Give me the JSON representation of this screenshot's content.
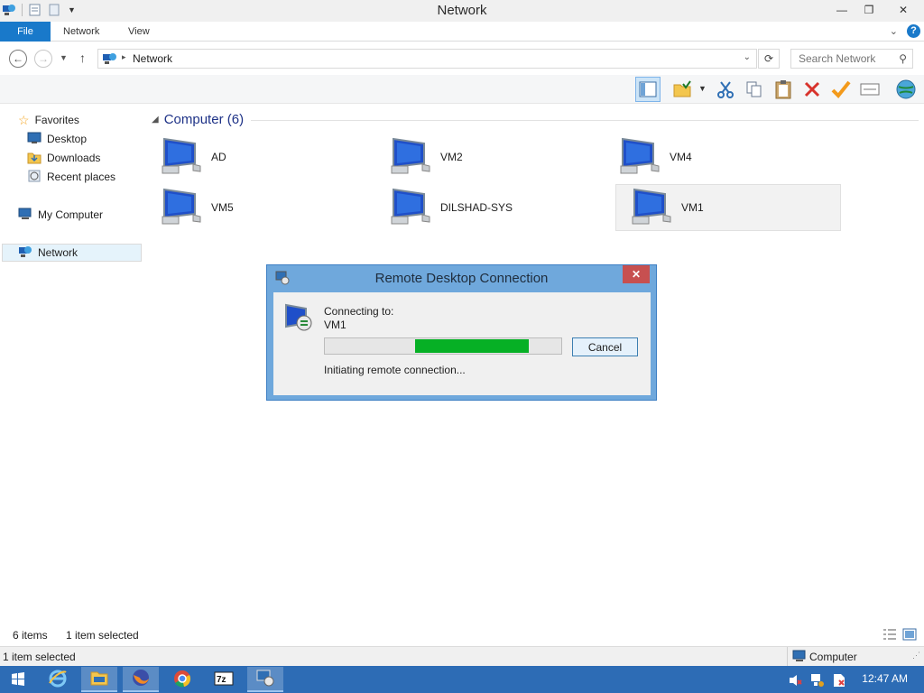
{
  "window": {
    "title": "Network"
  },
  "ribbon": {
    "tabs": [
      {
        "label": "File"
      },
      {
        "label": "Network"
      },
      {
        "label": "View"
      }
    ]
  },
  "address": {
    "crumb": "Network"
  },
  "search": {
    "placeholder": "Search Network"
  },
  "toolbar": {
    "icons": [
      "layout-pane-icon",
      "folder-properties-icon",
      "cut-icon",
      "copy-icon",
      "paste-icon",
      "delete-icon",
      "checkmark-icon",
      "rename-icon",
      "globe-icon"
    ]
  },
  "navpane": {
    "favorites": "Favorites",
    "desktop": "Desktop",
    "downloads": "Downloads",
    "recent": "Recent places",
    "computer": "My Computer",
    "network": "Network"
  },
  "content": {
    "group_header": "Computer (6)",
    "computers": [
      {
        "name": "AD"
      },
      {
        "name": "VM2"
      },
      {
        "name": "VM4"
      },
      {
        "name": "VM5"
      },
      {
        "name": "DILSHAD-SYS"
      },
      {
        "name": "VM1"
      }
    ],
    "selected": "VM1"
  },
  "status": {
    "items": "6 items",
    "selected": "1 item selected",
    "bottom_left": "1 item selected",
    "bottom_right": "Computer"
  },
  "dialog": {
    "title": "Remote Desktop Connection",
    "connecting_label": "Connecting to:",
    "target": "VM1",
    "progress_start": 0.38,
    "progress_end": 0.86,
    "cancel_label": "Cancel",
    "status_text": "Initiating remote connection..."
  },
  "taskbar": {
    "items": [
      "start-icon",
      "internet-explorer-icon",
      "file-explorer-icon",
      "firefox-icon",
      "chrome-icon",
      "7zip-icon",
      "remote-desktop-icon"
    ],
    "clock": "12:47 AM"
  },
  "colors": {
    "accent": "#1979ca",
    "taskbar": "#2d6cb5",
    "progress": "#06b025",
    "dialog_frame": "#6fa8dc"
  }
}
